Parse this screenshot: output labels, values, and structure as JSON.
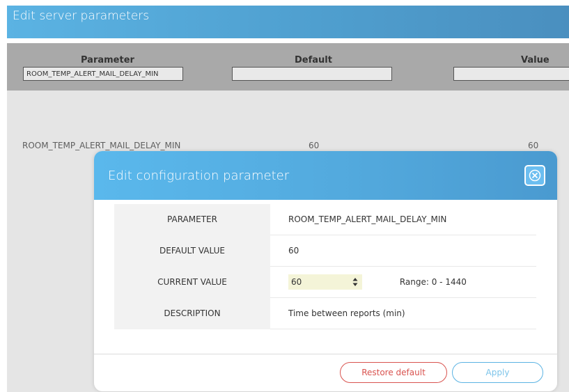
{
  "page": {
    "title": "Edit server parameters"
  },
  "filter_bar": {
    "columns": {
      "parameter": "Parameter",
      "default": "Default",
      "value": "Value"
    },
    "inputs": {
      "parameter_value": "ROOM_TEMP_ALERT_MAIL_DELAY_MIN",
      "default_value": "",
      "value_value": ""
    }
  },
  "table_row": {
    "name": "ROOM_TEMP_ALERT_MAIL_DELAY_MIN",
    "default": "60",
    "value": "60"
  },
  "modal": {
    "title": "Edit configuration parameter",
    "close_icon": "close-x-icon",
    "rows": {
      "parameter": {
        "label": "PARAMETER",
        "value": "ROOM_TEMP_ALERT_MAIL_DELAY_MIN"
      },
      "default_value": {
        "label": "DEFAULT VALUE",
        "value": "60"
      },
      "current_value": {
        "label": "CURRENT VALUE",
        "value": "60",
        "range": "Range: 0 - 1440"
      },
      "description": {
        "label": "DESCRIPTION",
        "value": "Time between reports (min)"
      }
    },
    "buttons": {
      "restore": "Restore default",
      "apply": "Apply"
    }
  },
  "colors": {
    "header_blue": "#5bb3e3",
    "restore_red": "#d9534f",
    "apply_blue": "#5bb3e3",
    "stepper_bg": "#f4f4d8"
  }
}
